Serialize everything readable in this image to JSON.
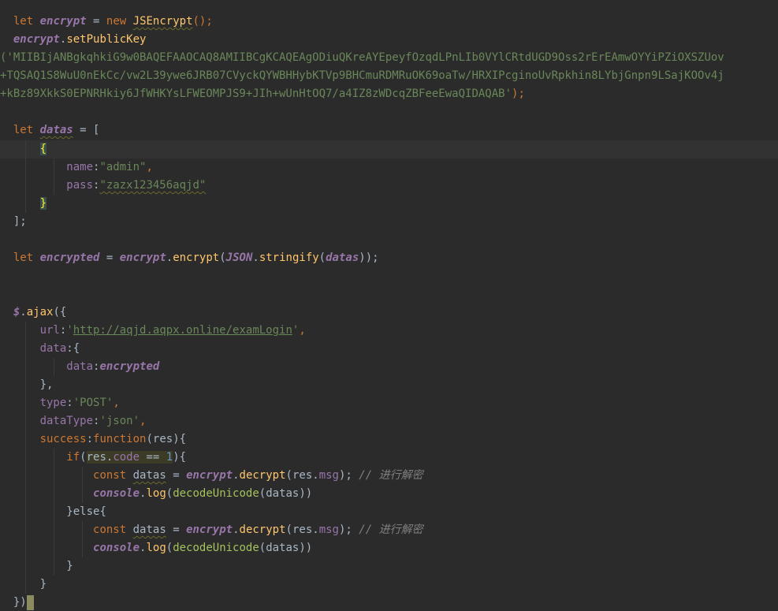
{
  "code": {
    "l1_let": "let",
    "l1_var": "encrypt",
    "l1_eq": " = ",
    "l1_new": "new",
    "l1_cls": "JSEncrypt",
    "l1_end": "();",
    "l2_obj": "encrypt",
    "l2_dot": ".",
    "l2_fn": "setPublicKey",
    "l3_key": "('MIIBIjANBgkqhkiG9w0BAQEFAAOCAQ8AMIIBCgKCAQEAgODiuQKreAYEpeyfOzqdLPnLIb0VYlCRtdUGD9Oss2rErEAmwOYYiPZiOXSZUov",
    "l4_key": "+TQSAQ1S8WuU0nEkCc/vw2L39ywe6JRB07CVyckQYWBHHybKTVp9BHCmuRDMRuOK69oaTw/HRXIPcginoUvRpkhin8LYbjGnpn9LSajKOOv4j",
    "l5_key": "+kBz89XkkS0EPNRHkiy6JfWHKYsLFWEOMPJS9+JIh+wUnHtOQ7/a4IZ8zWDcqZBFeeEwaQIDAQAB'",
    "l5_end": ");",
    "l7_let": "let",
    "l7_var": "datas",
    "l7_rest": " = [",
    "l8_open": "{",
    "l9_key": "name",
    "l9_val": "\"admin\"",
    "l10_key": "pass",
    "l10_val": "\"zazx123456aqjd\"",
    "l11_close": "}",
    "l12_close": "];",
    "l14_let": "let",
    "l14_var": "encrypted",
    "l14_eq": " = ",
    "l14_obj": "encrypt",
    "l14_fn": "encrypt",
    "l14_json": "JSON",
    "l14_str": "stringify",
    "l14_arg": "datas",
    "l14_end": "));",
    "l17_dollar": "$",
    "l17_fn": "ajax",
    "l17_open": "({",
    "l18_key": "url",
    "l18_val": "'http://aqjd.aqpx.online/examLogin'",
    "l19_key": "data",
    "l19_open": "{",
    "l20_key": "data",
    "l20_val": "encrypted",
    "l21_close": "},",
    "l22_key": "type",
    "l22_val": "'POST'",
    "l23_key": "dataType",
    "l23_val": "'json'",
    "l24_key": "success",
    "l24_fn": "function",
    "l24_arg": "res",
    "l25_if": "if",
    "l25_cond_res": "res",
    "l25_cond_code": "code",
    "l25_cond_op": " == ",
    "l25_cond_num": "1",
    "l26_const": "const",
    "l26_var": "datas",
    "l26_obj": "encrypt",
    "l26_fn": "decrypt",
    "l26_res": "res",
    "l26_msg": "msg",
    "l26_cmt": "// 进行解密",
    "l27_console": "console",
    "l27_log": "log",
    "l27_decode": "decodeUnicode",
    "l27_arg": "datas",
    "l28_else": "}else{",
    "l31_close": "}",
    "l32_close": "})"
  }
}
